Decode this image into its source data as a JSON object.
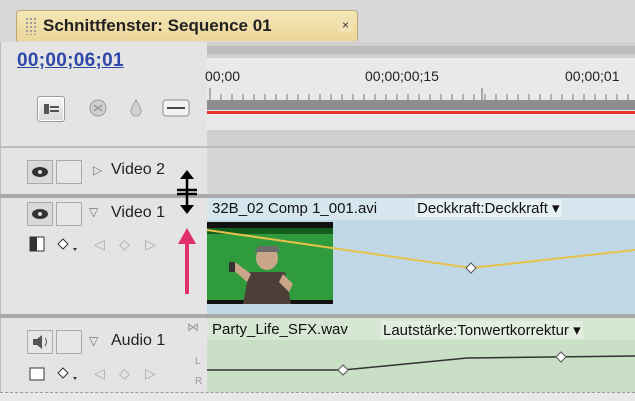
{
  "window": {
    "tab_title": "Schnittfenster: Sequence 01",
    "close_glyph": "×"
  },
  "timeline": {
    "timecode": "00;00;06;01",
    "ruler_times": [
      "00;00",
      "00;00;00;15",
      "00;00;01"
    ]
  },
  "tracks": {
    "video2": {
      "name": "Video 2"
    },
    "video1": {
      "name": "Video 1",
      "clip_name": "32B_02 Comp 1_001.avi",
      "property": "Deckkraft:Deckkraft",
      "menu_arrow": "▾"
    },
    "audio1": {
      "name": "Audio 1",
      "clip_name": "Party_Life_SFX.wav",
      "property": "Lautstärke:Tonwertkorrektur",
      "menu_arrow": "▾",
      "channel_left": "L",
      "channel_right": "R"
    }
  },
  "colors": {
    "timecode": "#2f48a8",
    "tab": "#ecd79a",
    "video_clip": "#c0d8e6",
    "audio_clip": "#c9dfc6",
    "playhead_line": "#e5332a",
    "callout_arrow": "#e0306a",
    "opacity_line": "#e6c24a"
  },
  "icons": [
    "snap-icon",
    "marker-icon",
    "drop-icon",
    "keyframe-icon",
    "eye-icon",
    "speaker-icon",
    "resize-cursor-icon",
    "up-arrow-icon"
  ]
}
